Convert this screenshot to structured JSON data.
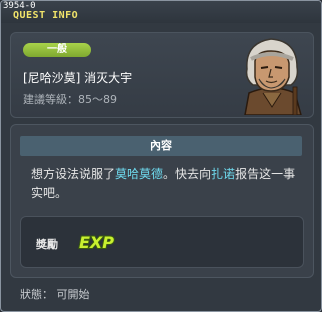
{
  "window": {
    "quest_id": "3954-0",
    "title": "QUEST INFO"
  },
  "header": {
    "category": "一般",
    "quest_name": "[尼哈沙莫] 消灭大宇",
    "recommend_level": "建議等級：85～89",
    "npc_icon": "old-man-portrait"
  },
  "content": {
    "heading": "內容",
    "description_parts": {
      "p1": "想方设法说服了",
      "h1": "莫哈莫德",
      "p2": "。快去向",
      "h2": "扎诺",
      "p3": "报告这一事实吧。"
    },
    "highlight_color": "#6fdcf0",
    "reward": {
      "label": "獎勵",
      "icon": "exp-icon",
      "icon_text": "EXP"
    }
  },
  "status": "狀態： 可開始",
  "colors": {
    "title": "#f0e36a",
    "badge": "#8fbd38",
    "heading_bar": "#4a6170"
  }
}
